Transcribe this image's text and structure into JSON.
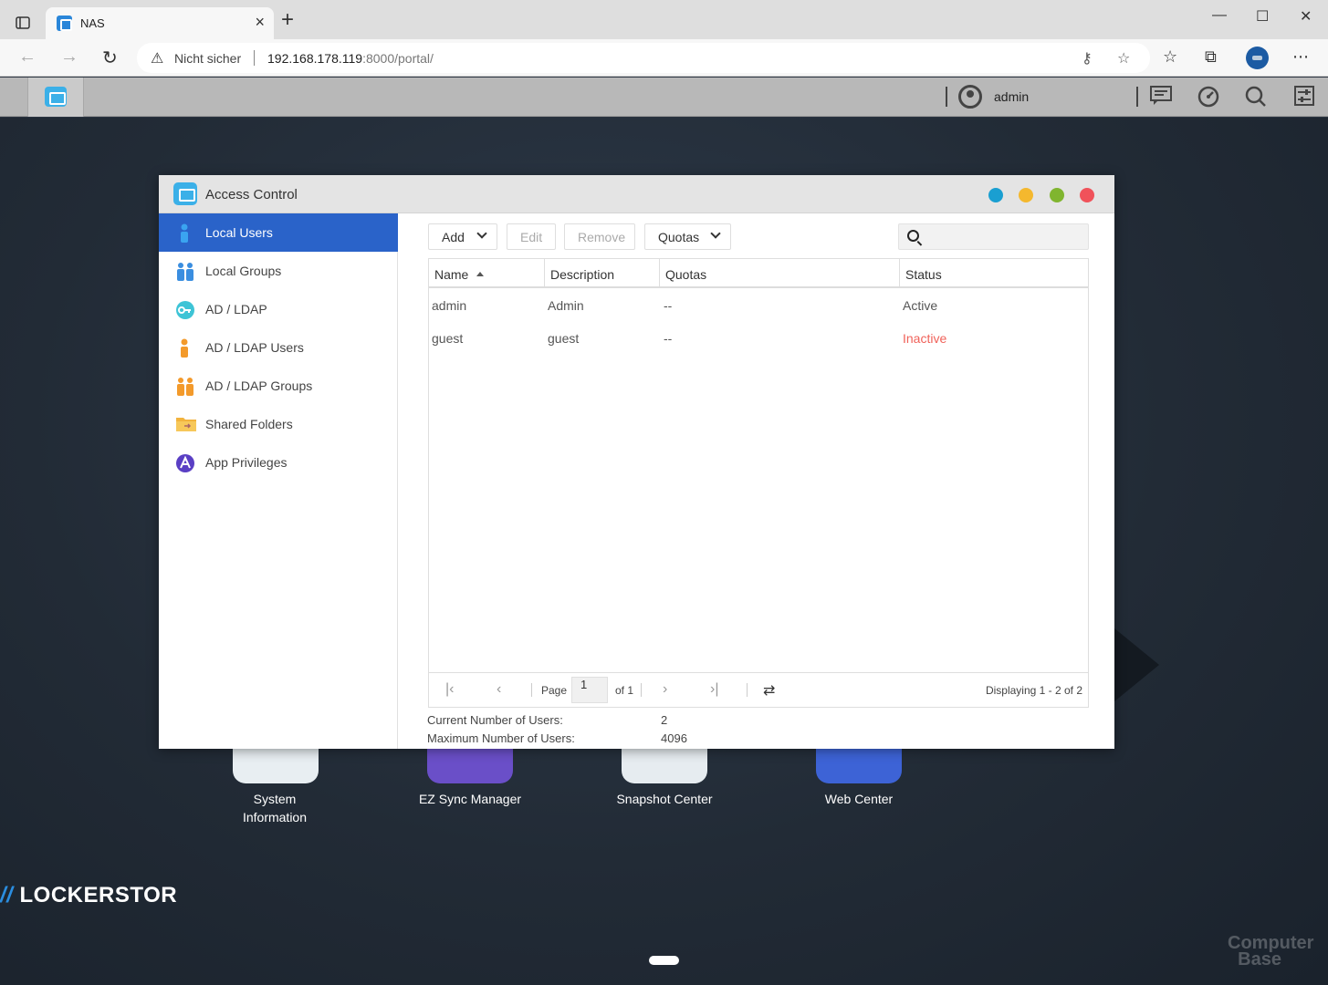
{
  "browser": {
    "tab_title": "NAS",
    "security_label": "Nicht sicher",
    "url_host": "192.168.178.119",
    "url_rest": ":8000/portal/"
  },
  "nas_topbar": {
    "username": "admin"
  },
  "window": {
    "title": "Access Control",
    "dot_colors": [
      "#1a9fd1",
      "#f4b82e",
      "#80b52f",
      "#f0525a"
    ]
  },
  "sidebar": {
    "items": [
      {
        "label": "Local Users",
        "icon": "user-icon",
        "active": true
      },
      {
        "label": "Local Groups",
        "icon": "users-group-icon"
      },
      {
        "label": "AD / LDAP",
        "icon": "ldap-key-icon"
      },
      {
        "label": "AD / LDAP Users",
        "icon": "ldap-user-icon"
      },
      {
        "label": "AD / LDAP Groups",
        "icon": "ldap-group-icon"
      },
      {
        "label": "Shared Folders",
        "icon": "folder-icon"
      },
      {
        "label": "App Privileges",
        "icon": "app-privileges-icon"
      }
    ]
  },
  "toolbar": {
    "add_label": "Add",
    "edit_label": "Edit",
    "remove_label": "Remove",
    "quotas_label": "Quotas",
    "search_placeholder": ""
  },
  "table": {
    "columns": [
      "Name",
      "Description",
      "Quotas",
      "Status"
    ],
    "rows": [
      {
        "name": "admin",
        "description": "Admin",
        "quotas": "--",
        "status": "Active"
      },
      {
        "name": "guest",
        "description": "guest",
        "quotas": "--",
        "status": "Inactive"
      }
    ]
  },
  "pager": {
    "page_label": "Page",
    "page_value": "1",
    "of_label": "of 1",
    "displaying": "Displaying 1 - 2 of 2"
  },
  "stats": {
    "current_label": "Current Number of Users:",
    "current_value": "2",
    "max_label": "Maximum Number of Users:",
    "max_value": "4096"
  },
  "desktop": {
    "apps": [
      {
        "label_line1": "System",
        "label_line2": "Information",
        "color": "#e8eef2"
      },
      {
        "label_line1": "EZ Sync Manager",
        "label_line2": "",
        "color": "#6a4fc8"
      },
      {
        "label_line1": "Snapshot Center",
        "label_line2": "",
        "color": "#e6ecf0"
      },
      {
        "label_line1": "Web Center",
        "label_line2": "",
        "color": "#3d63d6"
      }
    ],
    "brand": "LOCKERSTOR",
    "watermark_line1": "Computer",
    "watermark_line2": "Base"
  }
}
